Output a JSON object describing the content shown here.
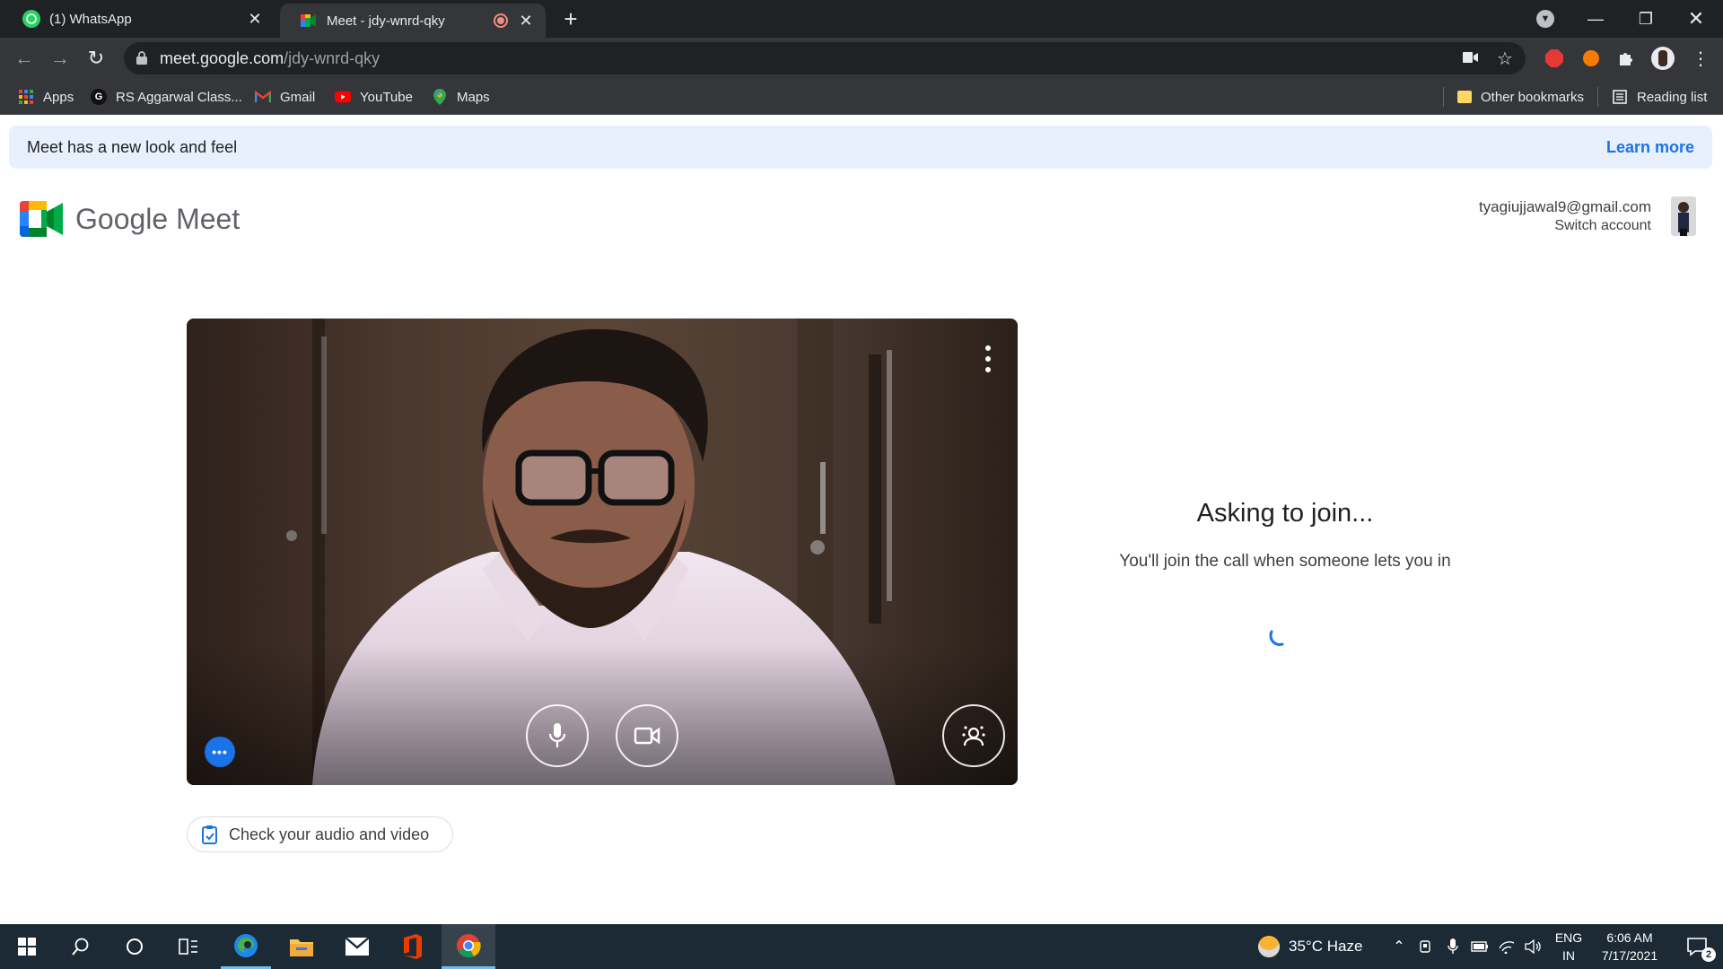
{
  "browser": {
    "tabs": [
      {
        "title": "(1) WhatsApp",
        "active": false
      },
      {
        "title": "Meet - jdy-wnrd-qky",
        "active": true,
        "recording": true
      }
    ],
    "url_domain": "meet.google.com",
    "url_path": "/jdy-wnrd-qky",
    "bookmarks": [
      {
        "label": "Apps",
        "icon": "apps-grid-icon"
      },
      {
        "label": "RS Aggarwal Class...",
        "icon": "g-site-icon"
      },
      {
        "label": "Gmail",
        "icon": "gmail-icon"
      },
      {
        "label": "YouTube",
        "icon": "youtube-icon"
      },
      {
        "label": "Maps",
        "icon": "maps-icon"
      }
    ],
    "other_bookmarks": "Other bookmarks",
    "reading_list": "Reading list"
  },
  "banner": {
    "text": "Meet has a new look and feel",
    "link": "Learn more"
  },
  "header": {
    "wordmark": "Google Meet",
    "account_email": "tyagiujjawal9@gmail.com",
    "switch_account": "Switch account"
  },
  "preview": {
    "more_options_icon": "more-vert-icon",
    "mic_icon": "microphone-icon",
    "camera_icon": "video-camera-icon",
    "effects_icon": "visual-effects-icon",
    "effects_dot": "•••"
  },
  "check_audio_video": "Check your audio and video",
  "join_status": {
    "title": "Asking to join...",
    "subtitle": "You'll join the call when someone lets you in"
  },
  "taskbar": {
    "weather": "35°C  Haze",
    "lang_1": "ENG",
    "lang_2": "IN",
    "time": "6:06 AM",
    "date": "7/17/2021",
    "notification_count": "2"
  },
  "colors": {
    "accent": "#1a73e8",
    "chrome_dark": "#202124",
    "chrome_toolbar": "#35363a",
    "banner_bg": "#e8f0fe",
    "taskbar": "#1b2a35"
  }
}
